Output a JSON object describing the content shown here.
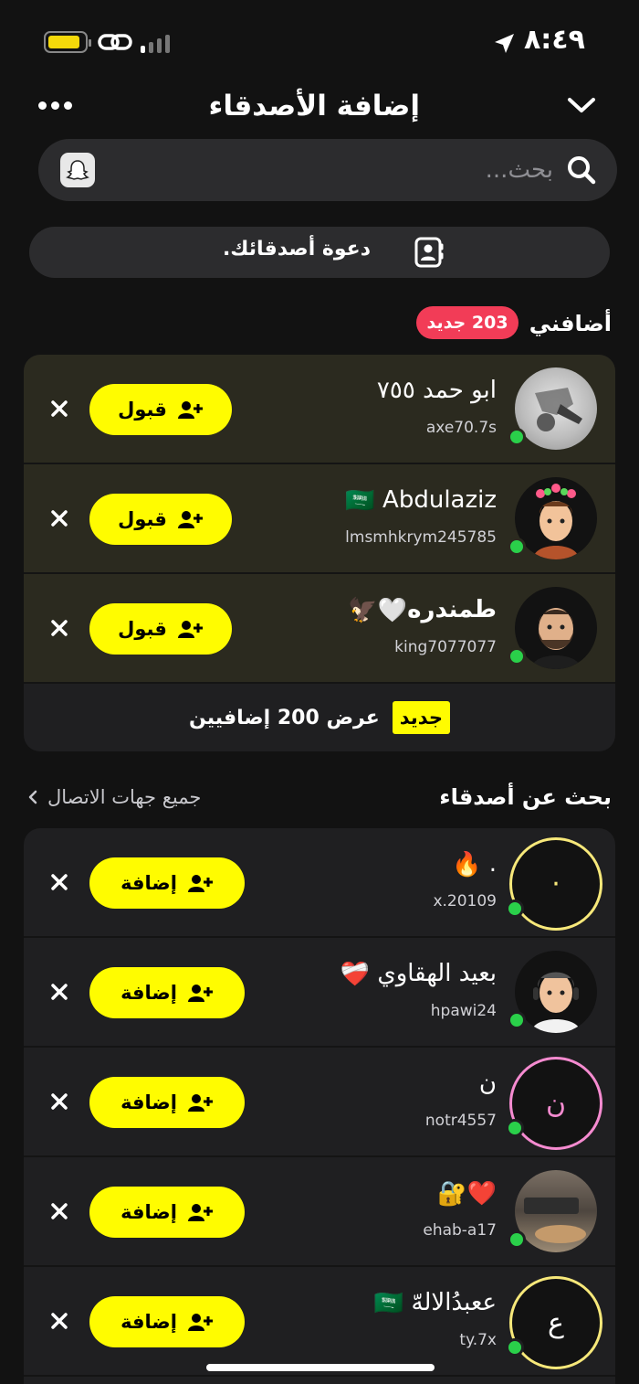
{
  "status_bar": {
    "time": "٨:٤٩",
    "battery_level": 0.85,
    "battery_color": "#f5d90a",
    "signal_bars_active": 1,
    "icons": [
      "battery-icon",
      "link-icon",
      "signal-icon",
      "location-arrow-icon"
    ]
  },
  "header": {
    "title": "إضافة الأصدقاء",
    "more_icon": "more-dots-icon",
    "collapse_icon": "chevron-down-icon"
  },
  "search": {
    "placeholder": "بحث...",
    "search_icon": "search-icon",
    "snapcode_icon": "ghost-icon"
  },
  "invite": {
    "label": "دعوة أصدقائك.",
    "icon": "contacts-icon"
  },
  "added_me": {
    "heading": "أضافني",
    "badge": "203 جديد",
    "badge_color": "#f23c57",
    "accept_label": "قبول",
    "requests": [
      {
        "name": "ابو حمد ٧٥٥",
        "username": "axe70.7s"
      },
      {
        "name": "Abdulaziz",
        "name_emoji": "🇸🇦",
        "username": "lmsmhkrym245785"
      },
      {
        "name": "طمندره",
        "name_emoji": "🤍🦅",
        "username": "king7077077"
      }
    ],
    "show_more_tag": "جديد",
    "show_more_text": "عرض 200 إضافيين"
  },
  "find_friends": {
    "heading": "بحث عن أصدقاء",
    "all_contacts": "جميع جهات الاتصال",
    "add_label": "إضافة",
    "suggestions": [
      {
        "name": ".",
        "name_emoji": "🔥",
        "username": "x.20109",
        "avatar_letter": "·",
        "ring_color": "#f7e87a"
      },
      {
        "name": "بعيد الهقاوي",
        "name_emoji": "❤️‍🩹",
        "username": "hpawi24"
      },
      {
        "name": "ن",
        "username": "notr4557",
        "avatar_letter": "ن",
        "ring_color": "#f58bd0"
      },
      {
        "name": "",
        "name_emoji": "❤️🔐",
        "username": "ehab-a17"
      },
      {
        "name": "ععبدُالالهّ",
        "name_emoji": "🇸🇦",
        "username": "ty.7x",
        "avatar_letter": "ع",
        "ring_color": "#f7e87a"
      }
    ]
  },
  "colors": {
    "accent_yellow": "#fffc00",
    "online_green": "#2ad04a",
    "background": "#121212"
  }
}
